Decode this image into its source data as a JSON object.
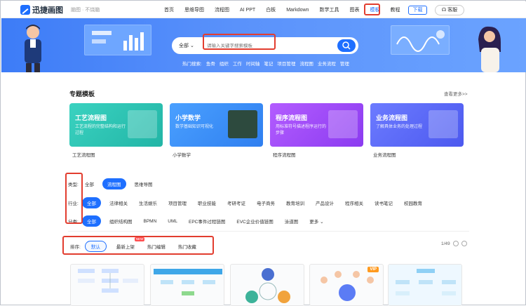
{
  "header": {
    "brand": "迅捷画图",
    "slogan": "脑图 · 不烧脑",
    "nav": [
      "首页",
      "思维导图",
      "流程图",
      "AI PPT",
      "白板",
      "Markdown",
      "数学工具",
      "图表",
      "模板",
      "教程"
    ],
    "active_nav": "模板",
    "download": "下载",
    "service": "客服"
  },
  "banner": {
    "search_category": "全部",
    "search_placeholder": "请输入关键字搜索模板",
    "hot_label": "热门搜索:",
    "hot_terms": [
      "鱼骨",
      "组织",
      "工作",
      "时间轴",
      "笔记",
      "项目管理",
      "流程图",
      "业务流程",
      "管理"
    ]
  },
  "featured": {
    "title": "专题模板",
    "more": "查看更多>>",
    "cards": [
      {
        "title": "工艺流程图",
        "desc": "工艺流程的完整结构和运行过程",
        "caption": "工艺流程图",
        "color": "#2ec7b8"
      },
      {
        "title": "小学数学",
        "desc": "数学基础知识可视化",
        "caption": "小学数学",
        "color": "#3a8dff"
      },
      {
        "title": "程序流程图",
        "desc": "用标准符号描述程序运行的步骤",
        "caption": "程序流程图",
        "color": "#a24cf6"
      },
      {
        "title": "业务流程图",
        "desc": "了解具体业务的处理过程",
        "caption": "业务流程图",
        "color": "#5d6bf7"
      }
    ]
  },
  "filters": {
    "type_label": "类型:",
    "types": [
      "全部",
      "流程图",
      "思维导图"
    ],
    "type_selected": "流程图",
    "industry_label": "行业:",
    "industries": [
      "全部",
      "法律相关",
      "生活娱乐",
      "项目管理",
      "职业技能",
      "考研考证",
      "电子商务",
      "教育培训",
      "产品设计",
      "程序相关",
      "读书笔记",
      "校园教育"
    ],
    "industry_selected": "全部",
    "category_label": "分类:",
    "categories": [
      "全部",
      "组织结构图",
      "BPMN",
      "UML",
      "EPC事件过程链图",
      "EVC企业价值链图",
      "泳道图",
      "更多"
    ],
    "category_selected": "全部"
  },
  "sort": {
    "label": "排序:",
    "options": [
      "默认",
      "最新上架",
      "热门编辑",
      "热门收藏"
    ],
    "selected": "默认",
    "new_badge": "NEW",
    "page": "1/49"
  },
  "thumbs": {
    "vip": "VIP"
  }
}
